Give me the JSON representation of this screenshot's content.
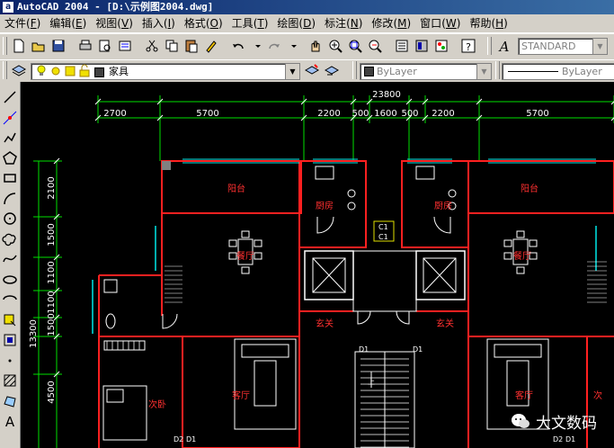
{
  "window": {
    "title": "AutoCAD 2004 - [D:\\示例图2004.dwg]"
  },
  "menu": [
    {
      "label": "文件",
      "key": "F"
    },
    {
      "label": "编辑",
      "key": "E"
    },
    {
      "label": "视图",
      "key": "V"
    },
    {
      "label": "插入",
      "key": "I"
    },
    {
      "label": "格式",
      "key": "O"
    },
    {
      "label": "工具",
      "key": "T"
    },
    {
      "label": "绘图",
      "key": "D"
    },
    {
      "label": "标注",
      "key": "N"
    },
    {
      "label": "修改",
      "key": "M"
    },
    {
      "label": "窗口",
      "key": "W"
    },
    {
      "label": "帮助",
      "key": "H"
    }
  ],
  "toolbar": {
    "text_style": "STANDARD",
    "layer_name": "家具",
    "color_control": "ByLayer",
    "linetype_control": "ByLayer"
  },
  "drawing": {
    "overall_width": "23800",
    "top_dims": [
      "2700",
      "5700",
      "2200",
      "500",
      "1600",
      "500",
      "2200",
      "5700"
    ],
    "left_overall": "13300",
    "left_dims": [
      "2100",
      "1500",
      "1100",
      "1100",
      "1500",
      "4500"
    ],
    "rooms": {
      "balcony_left": "阳台",
      "balcony_right": "阳台",
      "kitchen_left": "厨房",
      "kitchen_right": "厨房",
      "dining_left": "餐厅",
      "dining_right": "餐厅",
      "foyer_left": "玄关",
      "foyer_right": "玄关",
      "bedroom_left": "次卧",
      "living_left": "客厅",
      "living_right": "客厅",
      "bedroom_right_partial": "次"
    },
    "tags": {
      "tag_a": "C1",
      "tag_b": "C1",
      "d_left": "D1",
      "d_right": "D1",
      "d2_left": "D2",
      "d2_mid": "D1",
      "d2_right": "D2",
      "d1_right": "D1",
      "s_up": "上"
    }
  },
  "watermark": {
    "text": "大文数码"
  }
}
